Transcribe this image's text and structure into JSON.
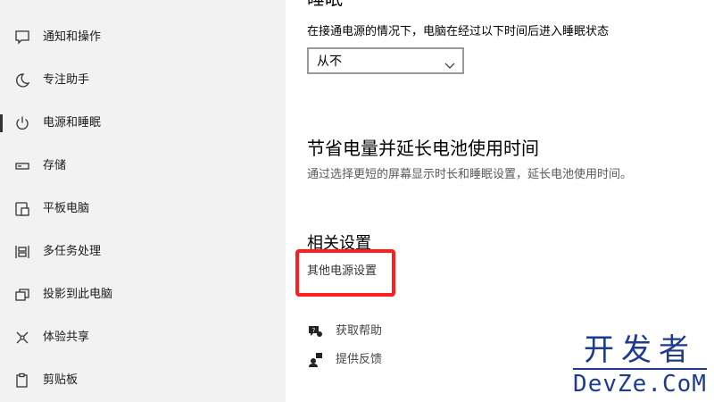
{
  "sidebar": {
    "items": [
      {
        "label": "通知和操作",
        "icon": "notification-icon"
      },
      {
        "label": "专注助手",
        "icon": "moon-icon"
      },
      {
        "label": "电源和睡眠",
        "icon": "power-icon",
        "selected": true
      },
      {
        "label": "存储",
        "icon": "storage-icon"
      },
      {
        "label": "平板电脑",
        "icon": "tablet-icon"
      },
      {
        "label": "多任务处理",
        "icon": "multitasking-icon"
      },
      {
        "label": "投影到此电脑",
        "icon": "project-icon"
      },
      {
        "label": "体验共享",
        "icon": "shared-experiences-icon"
      },
      {
        "label": "剪贴板",
        "icon": "clipboard-icon"
      }
    ]
  },
  "main": {
    "clipped_heading": "睡眠",
    "sleep_description": "在接通电源的情况下，电脑在经过以下时间后进入睡眠状态",
    "sleep_dropdown_value": "从不",
    "save_power_title": "节省电量并延长电池使用时间",
    "save_power_desc": "通过选择更短的屏幕显示时长和睡眠设置，延长电池使用时间。",
    "related_title": "相关设置",
    "related_link": "其他电源设置",
    "help": {
      "get_help": "获取帮助",
      "feedback": "提供反馈"
    }
  },
  "watermark": {
    "top": "开发者",
    "bottom": "DevZe.CoM"
  },
  "colors": {
    "sidebar_bg": "#f2f2f2",
    "highlight_box": "#ff1e1e",
    "watermark": "#1e3b8f"
  }
}
